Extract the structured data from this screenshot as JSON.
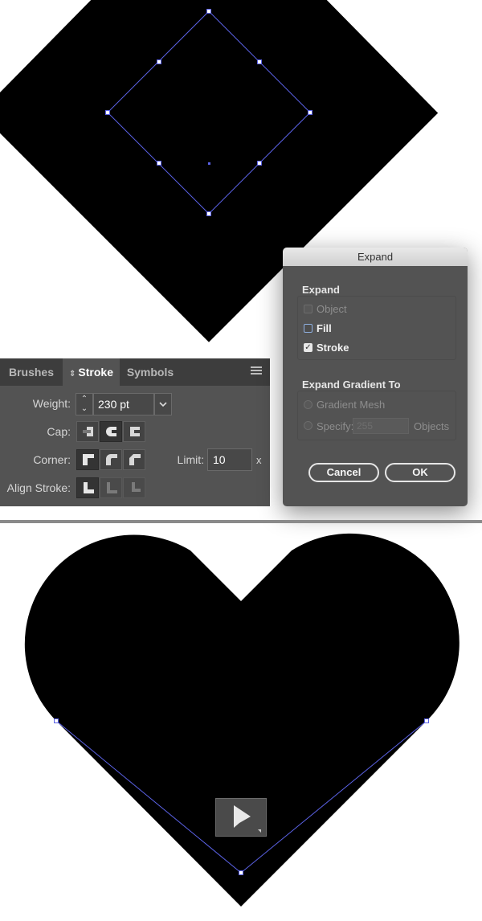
{
  "stroke_panel": {
    "tabs": [
      {
        "label": "Brushes",
        "active": false
      },
      {
        "label": "Stroke",
        "active": true
      },
      {
        "label": "Symbols",
        "active": false
      }
    ],
    "tab_active_prefix_icon": "up-down-arrows-icon",
    "menu_icon": "panel-menu-icon",
    "weight": {
      "label": "Weight:",
      "value": "230 pt"
    },
    "cap": {
      "label": "Cap:",
      "options": [
        "butt-cap-icon",
        "round-cap-icon",
        "projecting-cap-icon"
      ],
      "selected": 1
    },
    "corner": {
      "label": "Corner:",
      "options": [
        "miter-join-icon",
        "round-join-icon",
        "bevel-join-icon"
      ],
      "selected": 0
    },
    "limit": {
      "label": "Limit:",
      "value": "10",
      "suffix": "x"
    },
    "align_stroke": {
      "label": "Align Stroke:",
      "options": [
        "align-center-icon",
        "align-inside-icon",
        "align-outside-icon"
      ],
      "selected": 0
    }
  },
  "expand_dialog": {
    "title": "Expand",
    "expand_section": {
      "label": "Expand",
      "object": {
        "label": "Object",
        "checked": false,
        "enabled": false
      },
      "fill": {
        "label": "Fill",
        "checked": false,
        "enabled": true
      },
      "stroke": {
        "label": "Stroke",
        "checked": true,
        "enabled": true
      }
    },
    "gradient_section": {
      "label": "Expand Gradient To",
      "gradient_mesh": {
        "label": "Gradient Mesh",
        "enabled": false
      },
      "specify": {
        "label": "Specify:",
        "value": "255",
        "unit": "Objects",
        "enabled": false
      }
    },
    "cancel_label": "Cancel",
    "ok_label": "OK"
  },
  "tool": {
    "icon": "direct-selection-tool-icon"
  },
  "colors": {
    "panel_bg": "#535353",
    "tab_bar_bg": "#3d3d3d",
    "selection_blue": "#4a55d9",
    "artwork": "#000000"
  }
}
